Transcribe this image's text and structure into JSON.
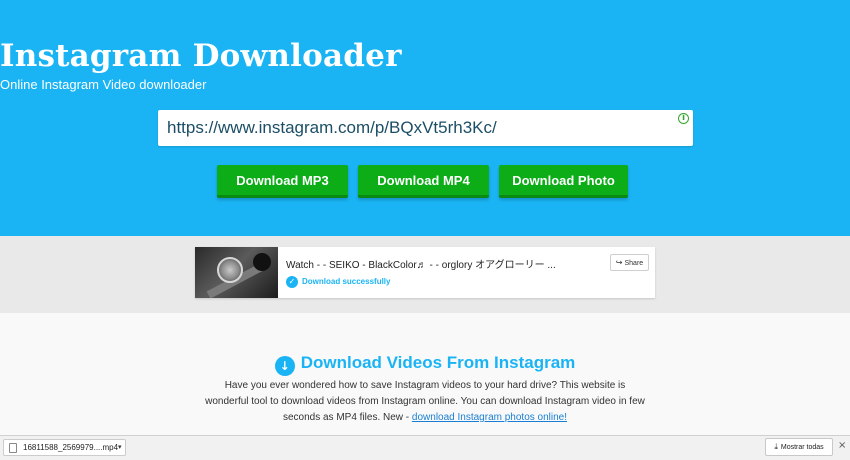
{
  "hero": {
    "title": "Instagram Downloader",
    "subtitle": "Online Instagram Video downloader",
    "background_color": "#1ab4f5"
  },
  "url_input": {
    "value": "https://www.instagram.com/p/BQxVt5rh3Kc/",
    "info_icon": "info-circle-icon",
    "info_glyph": "i"
  },
  "buttons": {
    "mp3": "Download MP3",
    "mp4": "Download MP4",
    "photo": "Download Photo",
    "color": "#0cad16"
  },
  "result": {
    "title": "Watch - - SEIKO - BlackColor♬ - - orglory オアグローリー ...",
    "status": "Download successfully",
    "status_icon": "check-circle-icon",
    "check_glyph": "✓",
    "share_label": "Share",
    "share_icon": "share-icon",
    "share_glyph": "↪"
  },
  "section": {
    "title": "Download Videos From Instagram",
    "icon": "download-circle-icon",
    "icon_glyph": "↓",
    "description": "Have you ever wondered how to save Instagram videos to your hard drive? This website is wonderful tool to download videos from Instagram online. You can download Instagram video in few seconds as MP4 files. New - ",
    "link_text": "download Instagram photos online!",
    "accent_color": "#1ab4f5"
  },
  "download_bar": {
    "file_name": "16811588_2569979....mp4",
    "caret_glyph": "▾",
    "show_all": "Mostrar todas",
    "show_all_glyph": "⤓",
    "close_glyph": "×"
  }
}
